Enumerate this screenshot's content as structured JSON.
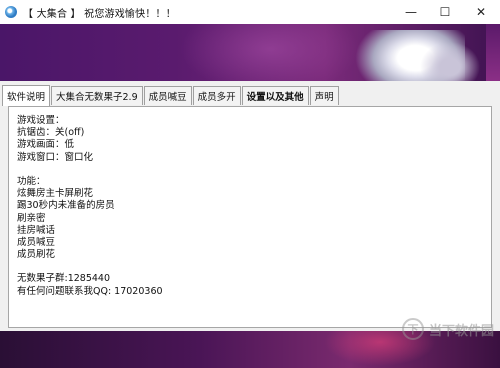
{
  "window": {
    "title": "【 大集合 】 祝您游戏愉快！！！",
    "controls": {
      "minimize": "—",
      "maximize": "☐",
      "close": "✕"
    }
  },
  "tabs": [
    {
      "label": "软件说明",
      "active": true
    },
    {
      "label": "大集合无数果子2.9",
      "active": false
    },
    {
      "label": "成员喊豆",
      "active": false
    },
    {
      "label": "成员多开",
      "active": false
    },
    {
      "label": "设置以及其他",
      "active": false
    },
    {
      "label": "声明",
      "active": false
    }
  ],
  "content": {
    "game_settings_header": "游戏设置：",
    "anti_aliasing": "抗锯齿：关(off)",
    "graphics": "游戏画面：低",
    "window_mode": "游戏窗口：窗口化",
    "features_header": "功能：",
    "features": [
      "炫舞房主卡屏刷花",
      "踢30秒内未准备的房员",
      "刷亲密",
      "挂房喊话",
      "成员喊豆",
      "成员刷花"
    ],
    "group_info": "无数果子群:1285440",
    "contact_info": "有任何问题联系我QQ: 17020360"
  },
  "watermark": {
    "icon_text": "下",
    "text": "当下软件园"
  }
}
